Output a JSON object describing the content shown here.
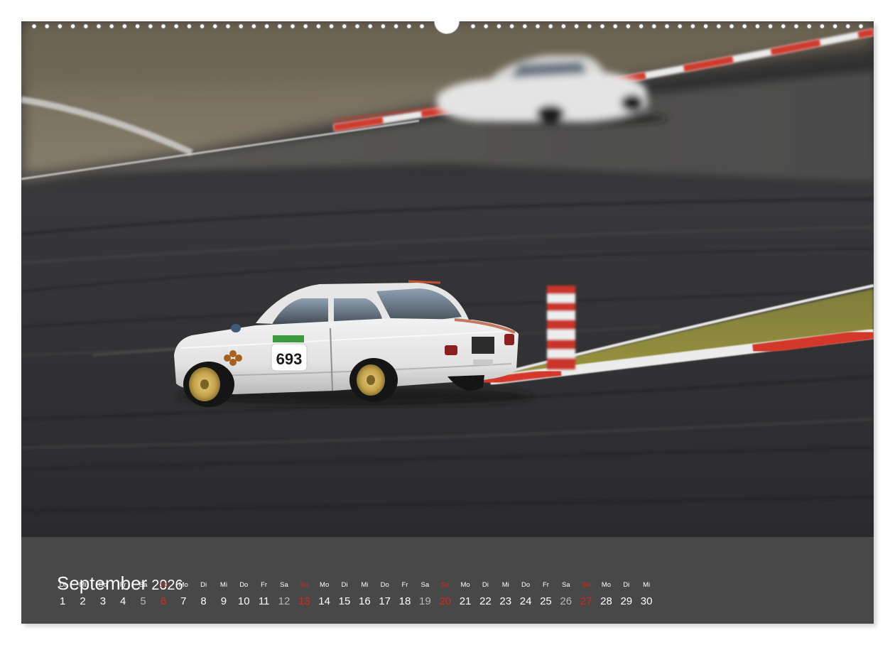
{
  "photo": {
    "subject": "classic white racing car on race track with motion blur",
    "car_number": "693",
    "colors": {
      "asphalt": "#3a3a3c",
      "curb_red": "#d3392c",
      "curb_white": "#ececec",
      "grass": "#8c8a3a",
      "car_white": "#e9e9e9",
      "wheel_gold": "#c9a94a"
    }
  },
  "calendar": {
    "month": "September",
    "year": "2026",
    "days": [
      {
        "wd": "Di",
        "n": "1",
        "t": "wk"
      },
      {
        "wd": "Mi",
        "n": "2",
        "t": "wk"
      },
      {
        "wd": "Do",
        "n": "3",
        "t": "wk"
      },
      {
        "wd": "Fr",
        "n": "4",
        "t": "wk"
      },
      {
        "wd": "Sa",
        "n": "5",
        "t": "sat"
      },
      {
        "wd": "So",
        "n": "6",
        "t": "sun"
      },
      {
        "wd": "Mo",
        "n": "7",
        "t": "wk"
      },
      {
        "wd": "Di",
        "n": "8",
        "t": "wk"
      },
      {
        "wd": "Mi",
        "n": "9",
        "t": "wk"
      },
      {
        "wd": "Do",
        "n": "10",
        "t": "wk"
      },
      {
        "wd": "Fr",
        "n": "11",
        "t": "wk"
      },
      {
        "wd": "Sa",
        "n": "12",
        "t": "sat"
      },
      {
        "wd": "So",
        "n": "13",
        "t": "sun"
      },
      {
        "wd": "Mo",
        "n": "14",
        "t": "wk"
      },
      {
        "wd": "Di",
        "n": "15",
        "t": "wk"
      },
      {
        "wd": "Mi",
        "n": "16",
        "t": "wk"
      },
      {
        "wd": "Do",
        "n": "17",
        "t": "wk"
      },
      {
        "wd": "Fr",
        "n": "18",
        "t": "wk"
      },
      {
        "wd": "Sa",
        "n": "19",
        "t": "sat"
      },
      {
        "wd": "So",
        "n": "20",
        "t": "sun"
      },
      {
        "wd": "Mo",
        "n": "21",
        "t": "wk"
      },
      {
        "wd": "Di",
        "n": "22",
        "t": "wk"
      },
      {
        "wd": "Mi",
        "n": "23",
        "t": "wk"
      },
      {
        "wd": "Do",
        "n": "24",
        "t": "wk"
      },
      {
        "wd": "Fr",
        "n": "25",
        "t": "wk"
      },
      {
        "wd": "Sa",
        "n": "26",
        "t": "sat"
      },
      {
        "wd": "So",
        "n": "27",
        "t": "sun"
      },
      {
        "wd": "Mo",
        "n": "28",
        "t": "wk"
      },
      {
        "wd": "Di",
        "n": "29",
        "t": "wk"
      },
      {
        "wd": "Mi",
        "n": "30",
        "t": "wk"
      }
    ],
    "colors": {
      "background": "#484848",
      "text": "#ffffff",
      "saturday": "#b8b8b8",
      "sunday": "#e0241d"
    }
  }
}
